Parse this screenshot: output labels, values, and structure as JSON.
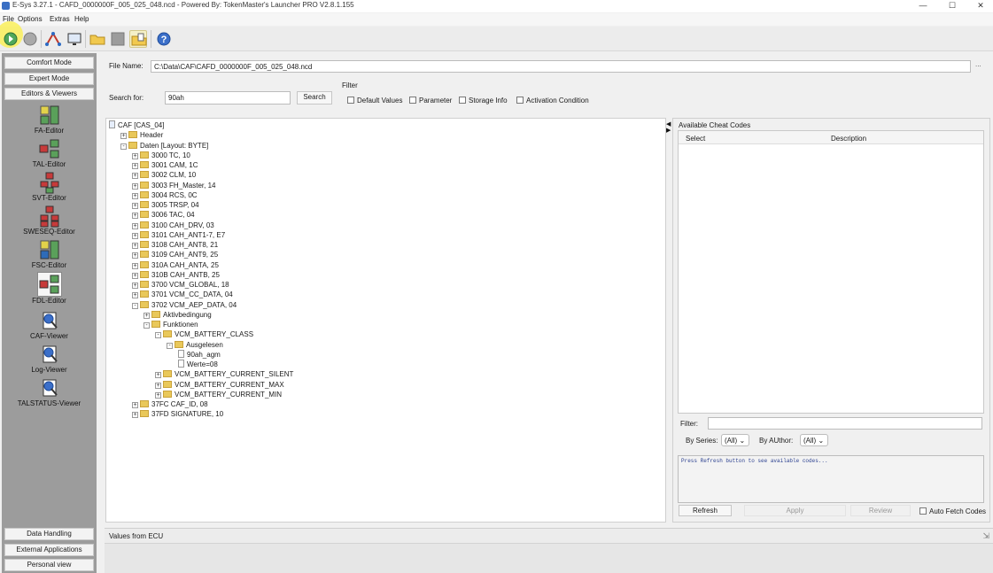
{
  "window": {
    "title": "E-Sys 3.27.1 - CAFD_0000000F_005_025_048.ncd              - Powered By: TokenMaster's Launcher PRO V2.8.1.155",
    "minimize": "—",
    "maximize": "☐",
    "close": "✕"
  },
  "menu": {
    "file": "File",
    "options": "Options",
    "extras": "Extras",
    "help": "Help"
  },
  "sidebar": {
    "modes": [
      "Comfort Mode",
      "Expert Mode",
      "Editors & Viewers"
    ],
    "editors": [
      "FA-Editor",
      "TAL-Editor",
      "SVT-Editor",
      "SWESEQ-Editor",
      "FSC-Editor",
      "FDL-Editor",
      "CAF-Viewer",
      "Log-Viewer",
      "TALSTATUS-Viewer"
    ],
    "bottom": [
      "Data Handling",
      "External Applications",
      "Personal view"
    ]
  },
  "file": {
    "label": "File Name:",
    "value": "C:\\Data\\CAF\\CAFD_0000000F_005_025_048.ncd",
    "browse": "..."
  },
  "search": {
    "label": "Search for:",
    "value": "90ah",
    "button": "Search"
  },
  "filter": {
    "title": "Filter",
    "options": [
      "Default Values",
      "Parameter",
      "Storage Info",
      "Activation Condition"
    ]
  },
  "tree": [
    {
      "text": "CAF [CAS_04]",
      "level": 0,
      "kind": "root"
    },
    {
      "text": "Header",
      "level": 1,
      "kind": "folder",
      "sign": "+"
    },
    {
      "text": "Daten [Layout: BYTE]",
      "level": 1,
      "kind": "folder",
      "sign": "-"
    },
    {
      "text": "3000 TC, 10",
      "level": 2,
      "kind": "folder",
      "sign": "+"
    },
    {
      "text": "3001 CAM, 1C",
      "level": 2,
      "kind": "folder",
      "sign": "+"
    },
    {
      "text": "3002 CLM, 10",
      "level": 2,
      "kind": "folder",
      "sign": "+"
    },
    {
      "text": "3003 FH_Master, 14",
      "level": 2,
      "kind": "folder",
      "sign": "+"
    },
    {
      "text": "3004 RCS, 0C",
      "level": 2,
      "kind": "folder",
      "sign": "+"
    },
    {
      "text": "3005 TRSP, 04",
      "level": 2,
      "kind": "folder",
      "sign": "+"
    },
    {
      "text": "3006 TAC, 04",
      "level": 2,
      "kind": "folder",
      "sign": "+"
    },
    {
      "text": "3100 CAH_DRV, 03",
      "level": 2,
      "kind": "folder",
      "sign": "+"
    },
    {
      "text": "3101 CAH_ANT1-7, E7",
      "level": 2,
      "kind": "folder",
      "sign": "+"
    },
    {
      "text": "3108 CAH_ANT8, 21",
      "level": 2,
      "kind": "folder",
      "sign": "+"
    },
    {
      "text": "3109 CAH_ANT9, 25",
      "level": 2,
      "kind": "folder",
      "sign": "+"
    },
    {
      "text": "310A CAH_ANTA, 25",
      "level": 2,
      "kind": "folder",
      "sign": "+"
    },
    {
      "text": "310B CAH_ANTB, 25",
      "level": 2,
      "kind": "folder",
      "sign": "+"
    },
    {
      "text": "3700 VCM_GLOBAL, 18",
      "level": 2,
      "kind": "folder",
      "sign": "+"
    },
    {
      "text": "3701 VCM_CC_DATA, 04",
      "level": 2,
      "kind": "folder",
      "sign": "+"
    },
    {
      "text": "3702 VCM_AEP_DATA, 04",
      "level": 2,
      "kind": "folder",
      "sign": "-"
    },
    {
      "text": "Aktivbedingung",
      "level": 3,
      "kind": "folder",
      "sign": "+"
    },
    {
      "text": "Funktionen",
      "level": 3,
      "kind": "folder",
      "sign": "-"
    },
    {
      "text": "VCM_BATTERY_CLASS",
      "level": 4,
      "kind": "folder",
      "sign": "-"
    },
    {
      "text": "Ausgelesen",
      "level": 5,
      "kind": "folder",
      "sign": "-"
    },
    {
      "text": "90ah_agm",
      "level": 6,
      "kind": "doc",
      "sign": ""
    },
    {
      "text": "Werte=08",
      "level": 6,
      "kind": "doc",
      "sign": ""
    },
    {
      "text": "VCM_BATTERY_CURRENT_SILENT",
      "level": 4,
      "kind": "folder",
      "sign": "+"
    },
    {
      "text": "VCM_BATTERY_CURRENT_MAX",
      "level": 4,
      "kind": "folder",
      "sign": "+"
    },
    {
      "text": "VCM_BATTERY_CURRENT_MIN",
      "level": 4,
      "kind": "folder",
      "sign": "+"
    },
    {
      "text": "37FC CAF_ID, 08",
      "level": 2,
      "kind": "folder",
      "sign": "+"
    },
    {
      "text": "37FD SIGNATURE, 10",
      "level": 2,
      "kind": "folder",
      "sign": "+"
    }
  ],
  "cheat": {
    "title": "Available Cheat Codes",
    "col_select": "Select",
    "col_desc": "Description",
    "filter_label": "Filter:",
    "by_series": "By Series:",
    "series_value": "(All)",
    "by_author": "By AUthor:",
    "author_value": "(All)",
    "message": "Press Refresh button to see available codes...",
    "refresh": "Refresh",
    "apply": "Apply",
    "review": "Review",
    "auto_fetch": "Auto Fetch Codes"
  },
  "bottom": {
    "title": "Values from ECU"
  }
}
